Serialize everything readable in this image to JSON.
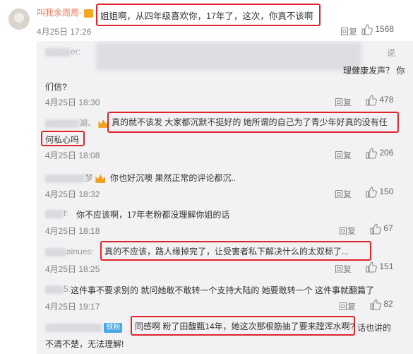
{
  "top_comment": {
    "username": "叫我余周周-",
    "text": "姐姐啊，从四年级喜欢你，17年了，这次，你真不该啊",
    "time": "4月25日 17:26",
    "reply_label": "回复",
    "likes": "1568"
  },
  "replies": [
    {
      "name_visible": "er:",
      "text_line1": "理健康发声？ 你",
      "text_line2": "们信?",
      "tail": "说",
      "time": "4月25日 18:30",
      "reply_label": "回复",
      "likes": "478"
    },
    {
      "name_visible": "湖、",
      "text_line1": "真的就不该发 大家都沉默不挺好的 她所谓的自己为了青少年好真的没有任",
      "text_line2": "何私心吗",
      "time": "4月25日 18:08",
      "reply_label": "回复",
      "likes": "206"
    },
    {
      "name_visible": "梦",
      "text_line1": "你也好沉噢 果然正常的评论都沉..",
      "time": "4月25日 18:32",
      "reply_label": "回复",
      "likes": "150"
    },
    {
      "name_visible": "f:",
      "text_line1": "你不应该啊，17年老粉都没理解你姐的话",
      "time": "4月25日 18:18",
      "reply_label": "回复",
      "likes": "67"
    },
    {
      "name_visible": "ainues:",
      "text_line1": "真的不应该，路人缘掉完了，让受害者私下解决什么的太双标了...",
      "time": "4月25日 18:25",
      "reply_label": "回复",
      "likes": "151"
    },
    {
      "name_visible": "5:",
      "text_line1": "这件事不要求别的 就问她敢不敢转一个支持大陆的 她要敢转一个 这件事就翻篇了",
      "time": "4月25日 19:17",
      "reply_label": "回复",
      "likes": "82"
    },
    {
      "badge": "铁粉",
      "text_line1": "同感啊 粉了田馥甄14年，她这次那根筋抽了要来蹚浑水啊?",
      "text_tail": "话也讲的",
      "text_line2": "不清不楚，无法理解!"
    }
  ],
  "colors": {
    "username": "#eb7350",
    "highlight_box": "#e0242a",
    "reply_bg": "#f2f2f5",
    "meta": "#808080"
  },
  "icons": [
    "vip-icon",
    "crown-icon",
    "thumb-up-icon"
  ]
}
